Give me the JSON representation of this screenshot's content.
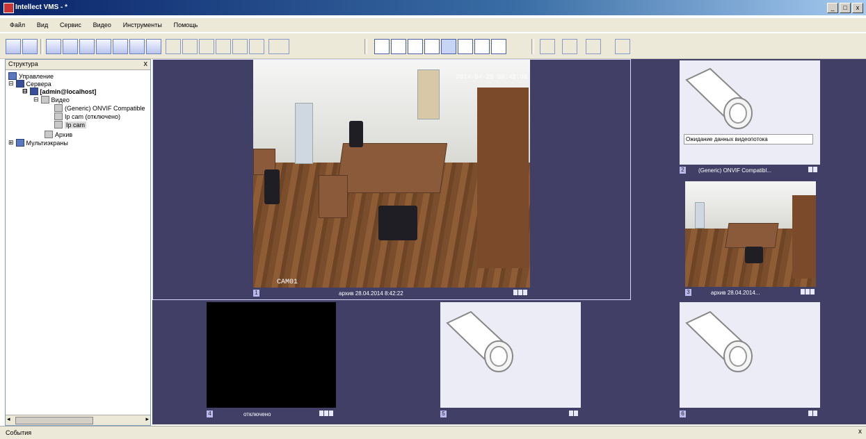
{
  "window": {
    "title": "Intellect VMS - *",
    "buttons": [
      "_",
      "□",
      "x"
    ]
  },
  "menu": [
    "Файл",
    "Вид",
    "Сервис",
    "Видео",
    "Инструменты",
    "Помощь"
  ],
  "left_panel": {
    "title": "Структура",
    "close": "x",
    "tree": [
      {
        "label": "Управление",
        "level": 0,
        "expander": ""
      },
      {
        "label": "Сервера",
        "level": 1,
        "expander": "⊟"
      },
      {
        "label": "[admin@localhost]",
        "level": 2,
        "expander": "⊟"
      },
      {
        "label": "Видео",
        "level": 3,
        "expander": "⊟"
      },
      {
        "label": "(Generic) ONVIF Compatible",
        "level": 4,
        "expander": ""
      },
      {
        "label": "Ip cam (отключено)",
        "level": 4,
        "expander": ""
      },
      {
        "label": "Ip cam",
        "level": 4,
        "expander": ""
      },
      {
        "label": "Архив",
        "level": 3,
        "expander": ""
      },
      {
        "label": "Мультиэкраны",
        "level": 0,
        "expander": "⊞"
      }
    ],
    "scroll_left": "◂",
    "scroll_right": "▸"
  },
  "cells": {
    "main": {
      "number": "1",
      "osd_time": "2014-04-28 08:42:38",
      "osd_name": "CAM01",
      "status": "архив 28.04.2014 8:42:22"
    },
    "right_top": {
      "number": "2",
      "message": "Ожидание данных видеопотока",
      "status": "(Generic) ONVIF Compatibl..."
    },
    "right_mid": {
      "number": "3",
      "status": "архив 28.04.2014..."
    },
    "bottom_left": {
      "number": "4",
      "status": "отключено"
    },
    "bottom_mid": {
      "number": "5",
      "status": ""
    },
    "bottom_right": {
      "number": "6",
      "status": ""
    }
  },
  "statusbar": {
    "text": "События",
    "close": "x"
  }
}
